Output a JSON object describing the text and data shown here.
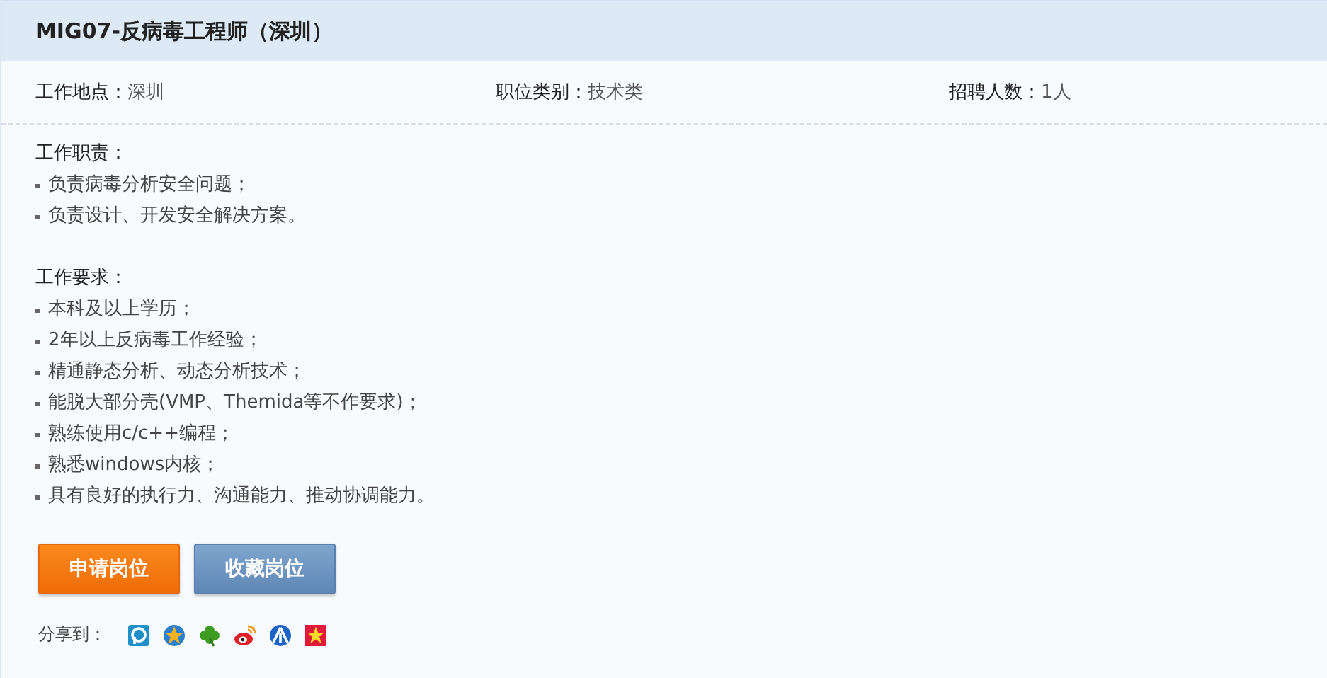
{
  "title": "MIG07-反病毒工程师（深圳）",
  "info": [
    {
      "label": "工作地点：",
      "value": "深圳"
    },
    {
      "label": "职位类别：",
      "value": "技术类"
    },
    {
      "label": "招聘人数：",
      "value": "1人"
    }
  ],
  "sections": [
    {
      "heading": "工作职责：",
      "items": [
        "负责病毒分析安全问题；",
        "负责设计、开发安全解决方案。"
      ]
    },
    {
      "heading": "工作要求：",
      "items": [
        "本科及以上学历；",
        "2年以上反病毒工作经验；",
        "精通静态分析、动态分析技术；",
        "能脱大部分壳(VMP、Themida等不作要求)；",
        "熟练使用c/c++编程；",
        "熟悉windows内核；",
        "具有良好的执行力、沟通能力、推动协调能力。"
      ]
    }
  ],
  "buttons": [
    {
      "label": "申请岗位",
      "kind": "primary"
    },
    {
      "label": "收藏岗位",
      "kind": "secondary"
    }
  ],
  "share": {
    "label": "分享到："
  }
}
